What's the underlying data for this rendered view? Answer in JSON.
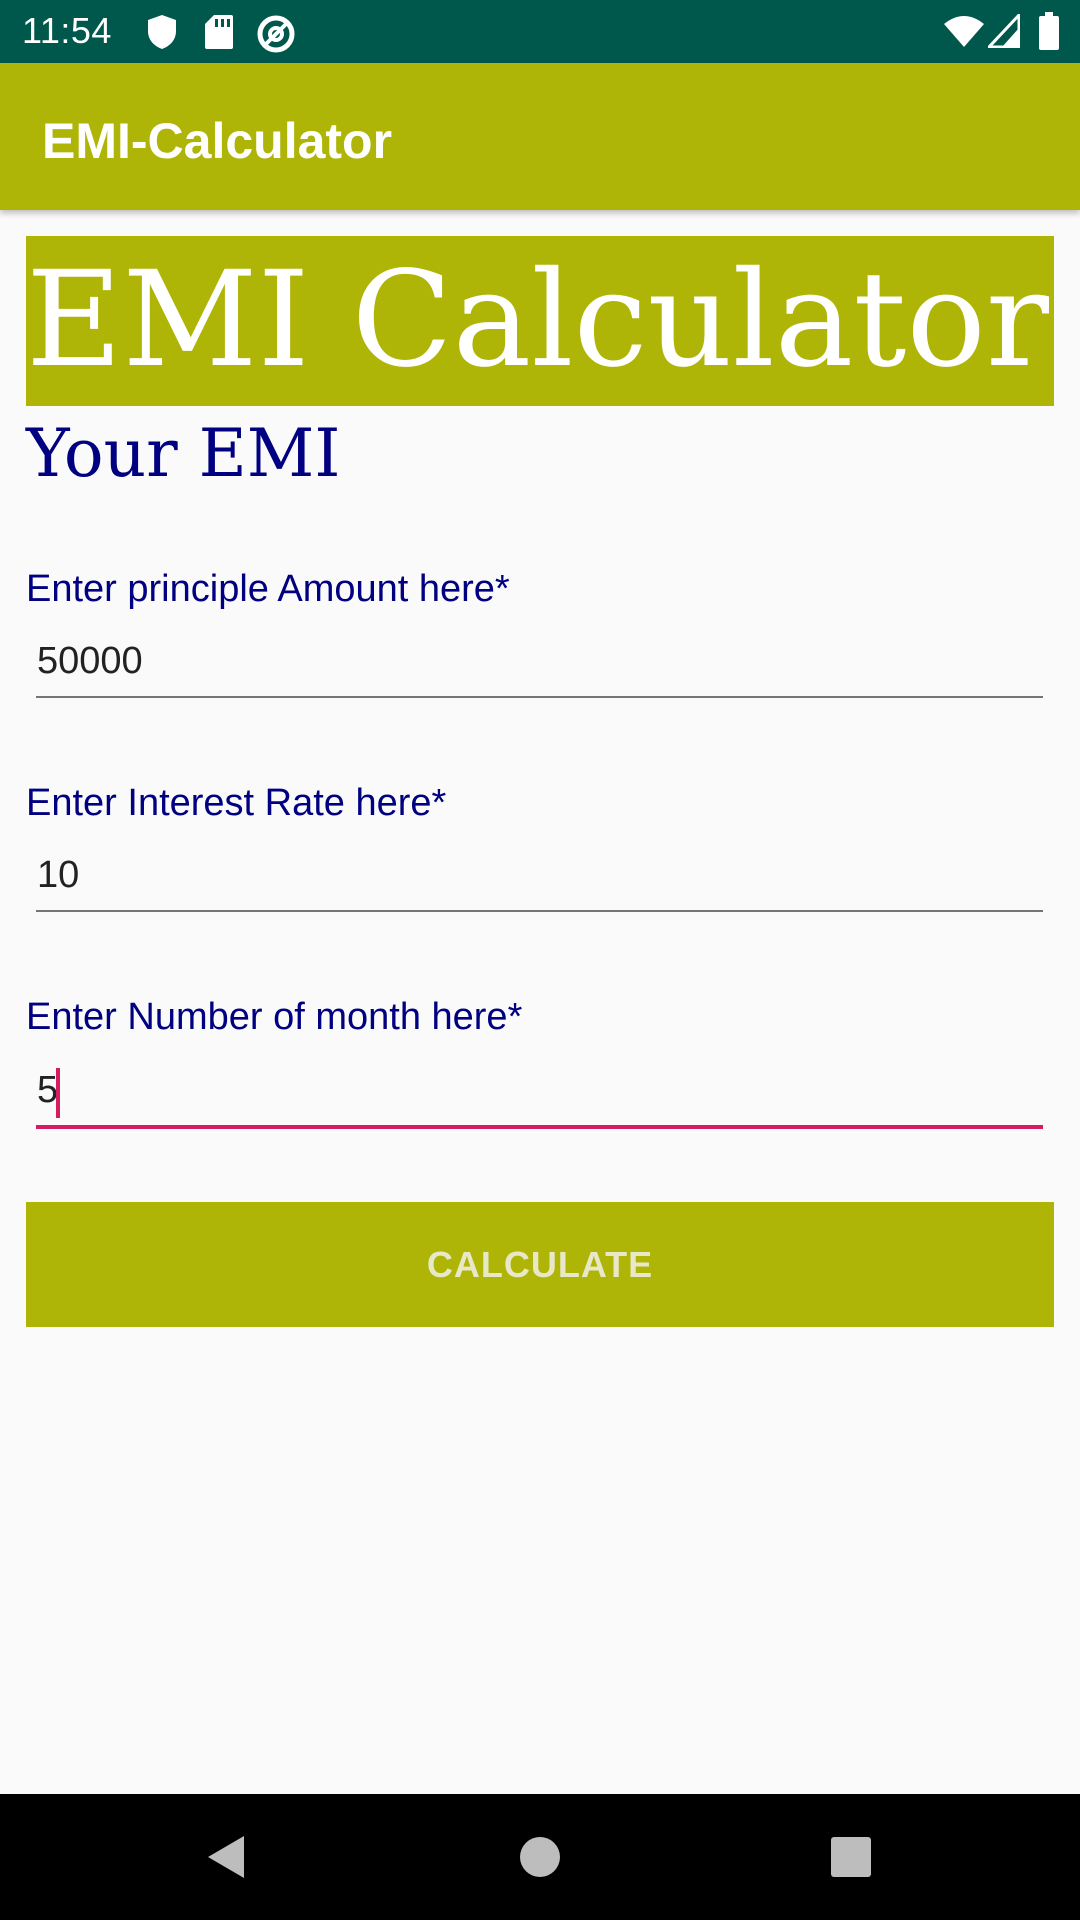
{
  "status_bar": {
    "time": "11:54",
    "left_icons": [
      "shield-icon",
      "sd-card-icon",
      "at-sign-icon"
    ],
    "right_icons": [
      "wifi-icon",
      "signal-icon",
      "battery-icon"
    ],
    "background": "#00574b"
  },
  "app_bar": {
    "title": "EMI-Calculator",
    "background": "#afb506"
  },
  "main": {
    "hero_title": "EMI Calculator",
    "result_label": "Your EMI",
    "fields": [
      {
        "label": "Enter principle Amount here*",
        "value": "50000"
      },
      {
        "label": "Enter Interest Rate here*",
        "value": "10"
      },
      {
        "label": "Enter Number of month here*",
        "value": "5",
        "focused": true
      }
    ],
    "calculate_button": "CALCULATE",
    "accent_color": "#d81b60",
    "label_color": "#000080"
  },
  "nav_bar": {
    "buttons": [
      "back-icon",
      "home-icon",
      "recents-icon"
    ]
  }
}
